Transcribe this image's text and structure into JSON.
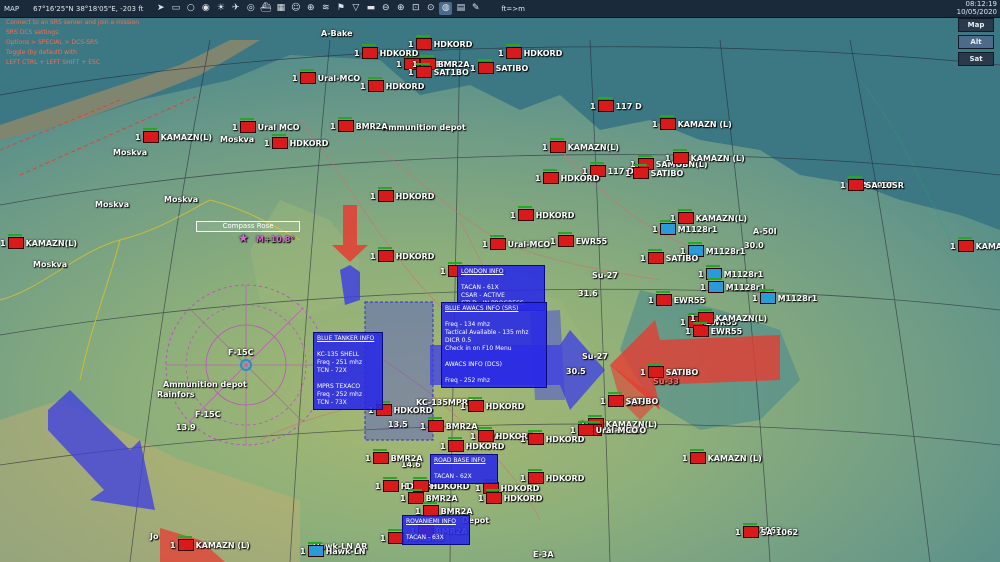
{
  "topbar": {
    "mode": "MAP",
    "coords": "67°16'25\"N 38°18'05\"E, -203 ft",
    "route": "ft=>m",
    "tools": [
      "cursor-icon",
      "ruler-icon",
      "circle-icon",
      "eye-icon",
      "sun-icon",
      "plane-icon",
      "radar-icon",
      "ship-icon",
      "grid-icon",
      "person-icon",
      "target-icon",
      "wifi-icon",
      "flag-icon",
      "filter-icon",
      "car-icon",
      "zoom-out-icon",
      "zoom-in-icon",
      "zoom-fit-icon",
      "zoom-reset-icon",
      "globe-icon",
      "layers-icon",
      "pencil-icon"
    ]
  },
  "clock": {
    "time": "08:12:19",
    "date": "10/05/2020"
  },
  "info_lines": [
    "SRS not connected",
    "Connect to an SRS server and join a mission",
    "SRS DCS settings:",
    "Options > SPECIAL > DCS-SRS",
    "Toggle (by default) with",
    "LEFT CTRL + LEFT SHIFT + ESC"
  ],
  "side_buttons": [
    {
      "label": "Map"
    },
    {
      "label": "Alt"
    },
    {
      "label": "Sat"
    }
  ],
  "compass": {
    "label": "Compass Rose",
    "bearing": "M+10.8°"
  },
  "places": [
    {
      "t": "Moskva"
    },
    {
      "t": "Moskva"
    },
    {
      "t": "Moskva"
    },
    {
      "t": "Moskva"
    },
    {
      "t": "Moskva"
    },
    {
      "t": "Ammunition depot"
    },
    {
      "t": "Rainfors"
    },
    {
      "t": "Ammunition depot"
    },
    {
      "t": "F-15C"
    },
    {
      "t": "F-15C"
    },
    {
      "t": "13.9"
    },
    {
      "t": "13.5"
    },
    {
      "t": "14.6"
    },
    {
      "t": "30.0"
    },
    {
      "t": "31.6"
    },
    {
      "t": "30.5"
    },
    {
      "t": "31.6"
    },
    {
      "t": "Su-27"
    },
    {
      "t": "Su-27"
    },
    {
      "t": "Su-33"
    },
    {
      "t": "KC-135MPRS"
    },
    {
      "t": "A-50I"
    },
    {
      "t": "Hawk-LN"
    },
    {
      "t": "AR"
    },
    {
      "t": "Jo"
    },
    {
      "t": "E-3A"
    },
    {
      "t": "Depot"
    },
    {
      "t": "SA-10SR"
    },
    {
      "t": "SA-1062"
    },
    {
      "t": "E-3A"
    },
    {
      "t": "A-Bake"
    }
  ],
  "units": [
    {
      "n": "1",
      "t": "HDKORD",
      "c": "red"
    },
    {
      "n": "1",
      "t": "BMR2A",
      "c": "red"
    },
    {
      "n": "1",
      "t": "HDKORD",
      "c": "red"
    },
    {
      "n": "1",
      "t": "HDKORD",
      "c": "red"
    },
    {
      "n": "1",
      "t": "BMR2A",
      "c": "red"
    },
    {
      "n": "1",
      "t": "SAT1BO",
      "c": "red"
    },
    {
      "n": "1",
      "t": "SATIBO",
      "c": "red"
    },
    {
      "n": "1",
      "t": "Ural-MCO",
      "c": "red"
    },
    {
      "n": "1",
      "t": "HDKORD",
      "c": "red"
    },
    {
      "n": "1",
      "t": "117 D",
      "c": "red"
    },
    {
      "n": "1",
      "t": "KAMAZN (L)",
      "c": "red"
    },
    {
      "n": "1",
      "t": "KAMAZN(L)",
      "c": "red"
    },
    {
      "n": "1",
      "t": "Ural MCO",
      "c": "red"
    },
    {
      "n": "1",
      "t": "BMR2A",
      "c": "red"
    },
    {
      "n": "1",
      "t": "HDKORD",
      "c": "red"
    },
    {
      "n": "1",
      "t": "KAMAZN(L)",
      "c": "red"
    },
    {
      "n": "1",
      "t": "117 D",
      "c": "red"
    },
    {
      "n": "1",
      "t": "SAMOBN(L)",
      "c": "red"
    },
    {
      "n": "1",
      "t": "KAMAZN (L)",
      "c": "red"
    },
    {
      "n": "1",
      "t": "HDKORD",
      "c": "red"
    },
    {
      "n": "1",
      "t": "SATIBO",
      "c": "red"
    },
    {
      "n": "1",
      "t": "HDKORD",
      "c": "red"
    },
    {
      "n": "1",
      "t": "SA-10SR",
      "c": "red"
    },
    {
      "n": "1",
      "t": "HDKORD",
      "c": "red"
    },
    {
      "n": "1",
      "t": "EWR55",
      "c": "red"
    },
    {
      "n": "1",
      "t": "M1128r1",
      "c": "blue"
    },
    {
      "n": "1",
      "t": "HDKORD",
      "c": "red"
    },
    {
      "n": "1",
      "t": "Ural-MCO",
      "c": "red"
    },
    {
      "n": "1",
      "t": "EWR55",
      "c": "red"
    },
    {
      "n": "1",
      "t": "M1128r1",
      "c": "blue"
    },
    {
      "n": "1",
      "t": "SATIBO",
      "c": "red"
    },
    {
      "n": "1",
      "t": "M1128r1",
      "c": "blue"
    },
    {
      "n": "1",
      "t": "EWR55",
      "c": "red"
    },
    {
      "n": "1",
      "t": "M1128r1",
      "c": "blue"
    },
    {
      "n": "1",
      "t": "M1128r1",
      "c": "blue"
    },
    {
      "n": "1",
      "t": "KAMAZN(L)",
      "c": "red"
    },
    {
      "n": "1",
      "t": "EWR55",
      "c": "red"
    },
    {
      "n": "1",
      "t": "HDKORD",
      "c": "red"
    },
    {
      "n": "1",
      "t": "KAMAZN(L)",
      "c": "red"
    },
    {
      "n": "1",
      "t": "Ural-MCO",
      "c": "red"
    },
    {
      "n": "1",
      "t": "SATIBO",
      "c": "red"
    },
    {
      "n": "1",
      "t": "HDKORD",
      "c": "red"
    },
    {
      "n": "1",
      "t": "BMR2A",
      "c": "red"
    },
    {
      "n": "1",
      "t": "HDKORD",
      "c": "red"
    },
    {
      "n": "1",
      "t": "BMR2A",
      "c": "red"
    },
    {
      "n": "1",
      "t": "HDKORD",
      "c": "red"
    },
    {
      "n": "1",
      "t": "HDKORD",
      "c": "red"
    },
    {
      "n": "1",
      "t": "BMR2A",
      "c": "red"
    },
    {
      "n": "1",
      "t": "HDKORD",
      "c": "red"
    },
    {
      "n": "1",
      "t": "BMR2A",
      "c": "red"
    },
    {
      "n": "1",
      "t": "KAMAZN (L)",
      "c": "red"
    },
    {
      "n": "1",
      "t": "HDKORD",
      "c": "red"
    },
    {
      "n": "1",
      "t": "KAMAZN (L)",
      "c": "red"
    },
    {
      "n": "1",
      "t": "SA-1062",
      "c": "red"
    },
    {
      "n": "1",
      "t": "HDKORD",
      "c": "red"
    },
    {
      "n": "1",
      "t": "BMR2A",
      "c": "red"
    },
    {
      "n": "1",
      "t": "Hawk-LN",
      "c": "blue"
    },
    {
      "n": "1",
      "t": "KAMAZN(L)",
      "c": "red"
    },
    {
      "n": "1",
      "t": "HDKORD",
      "c": "red"
    },
    {
      "n": "1",
      "t": "KAMAZN (L)",
      "c": "red"
    },
    {
      "n": "1",
      "t": "HDKORD",
      "c": "red"
    },
    {
      "n": "1",
      "t": "SATIBO",
      "c": "red"
    },
    {
      "n": "1",
      "t": "Ural-MCO",
      "c": "red"
    },
    {
      "n": "1",
      "t": "HDKORD",
      "c": "red"
    },
    {
      "n": "1",
      "t": "KAMAZN(L)",
      "c": "red"
    },
    {
      "n": "1",
      "t": "HDKORD",
      "c": "red"
    }
  ],
  "panels": [
    {
      "lines": [
        "BLUE TANKER INFO",
        "",
        "KC-135 SHELL",
        "Freq - 251 mhz",
        "TCN - 72X",
        "",
        "MPRS TEXACO",
        "Freq - 252 mhz",
        "TCN - 73X"
      ]
    },
    {
      "lines": [
        "LONDON INFO",
        "",
        "TACAN - 61X",
        "CSAR - ACTIVE",
        "CTLD - IN PROGRESS"
      ]
    },
    {
      "lines": [
        "BLUE AWACS INFO (SRS)",
        "",
        "Freq - 134 mhz",
        "Tactical Available - 135 mhz",
        "DICR 0.5",
        "Check in on F10 Menu",
        "",
        "AWACS INFO (DCS)",
        "",
        "Freq - 252 mhz"
      ]
    },
    {
      "lines": [
        "ROAD BASE INFO",
        "",
        "TACAN - 62X"
      ]
    },
    {
      "lines": [
        "ROVANIEMI INFO",
        "",
        "TACAN - 63X"
      ]
    }
  ]
}
